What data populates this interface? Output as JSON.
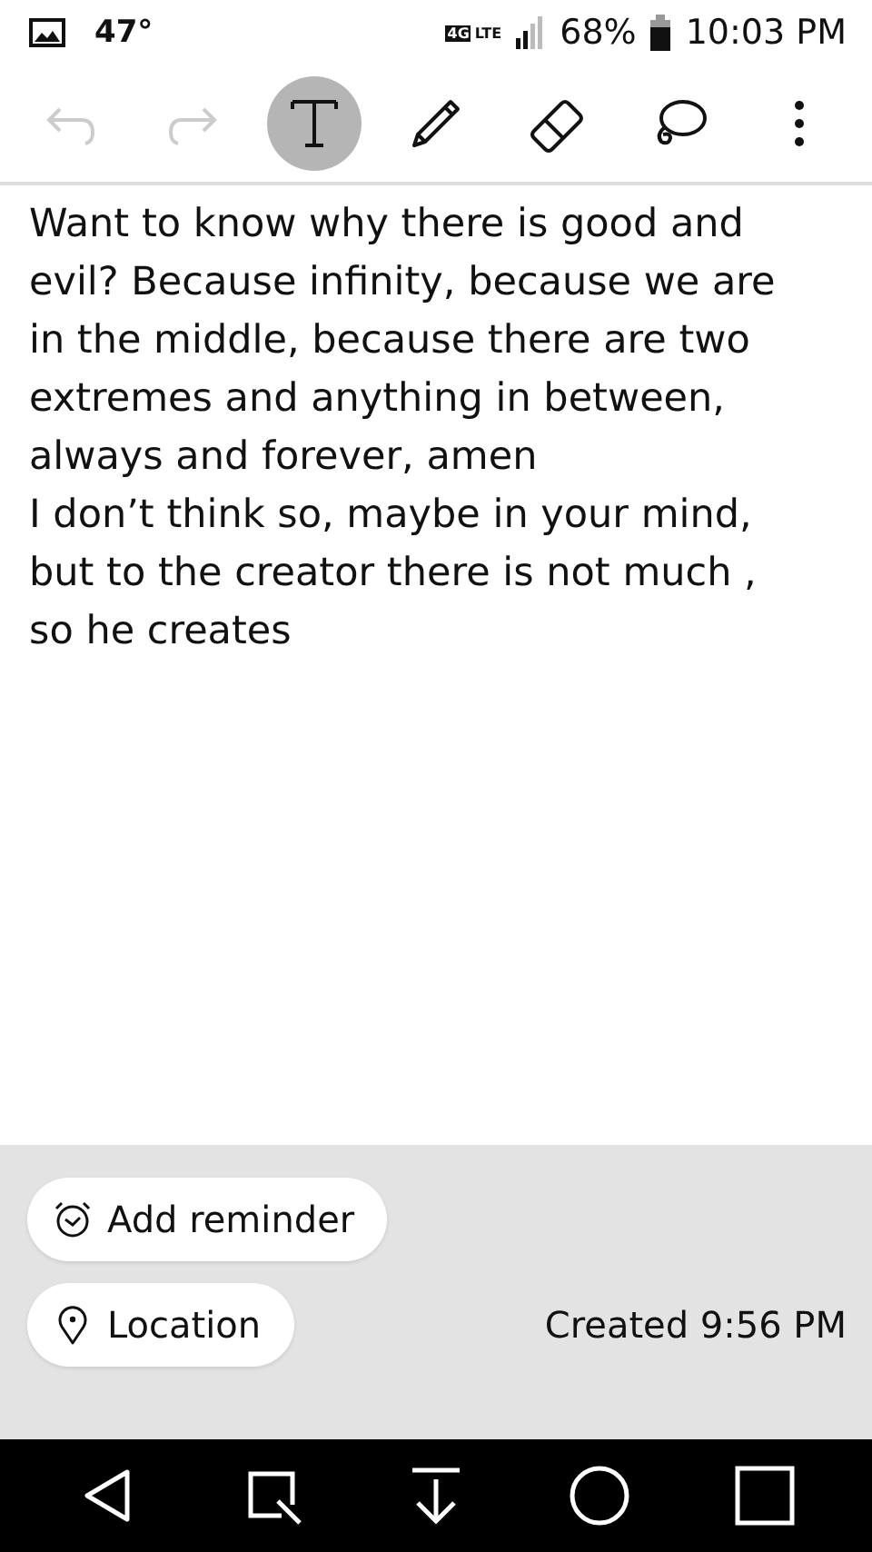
{
  "status_bar": {
    "temperature": "47°",
    "network": "4G",
    "network_type": "LTE",
    "battery": "68%",
    "time": "10:03 PM"
  },
  "toolbar": [
    {
      "kind": "undo",
      "disabled": true,
      "selected": false
    },
    {
      "kind": "redo",
      "disabled": true,
      "selected": false
    },
    {
      "kind": "text",
      "disabled": false,
      "selected": true
    },
    {
      "kind": "pen",
      "disabled": false,
      "selected": false
    },
    {
      "kind": "eraser",
      "disabled": false,
      "selected": false
    },
    {
      "kind": "lasso",
      "disabled": false,
      "selected": false
    },
    {
      "kind": "more",
      "disabled": false,
      "selected": false
    }
  ],
  "note": {
    "paragraphs": [
      "Want to know why there is good and evil? Because infinity, because we are in the middle, because there are two extremes and anything in between, always and forever, amen",
      "I don’t think so, maybe in your mind, but to the creator there is not much , so he creates"
    ]
  },
  "footer": {
    "reminder_button": "Add reminder",
    "location_button": "Location",
    "created": "Created 9:56 PM"
  }
}
